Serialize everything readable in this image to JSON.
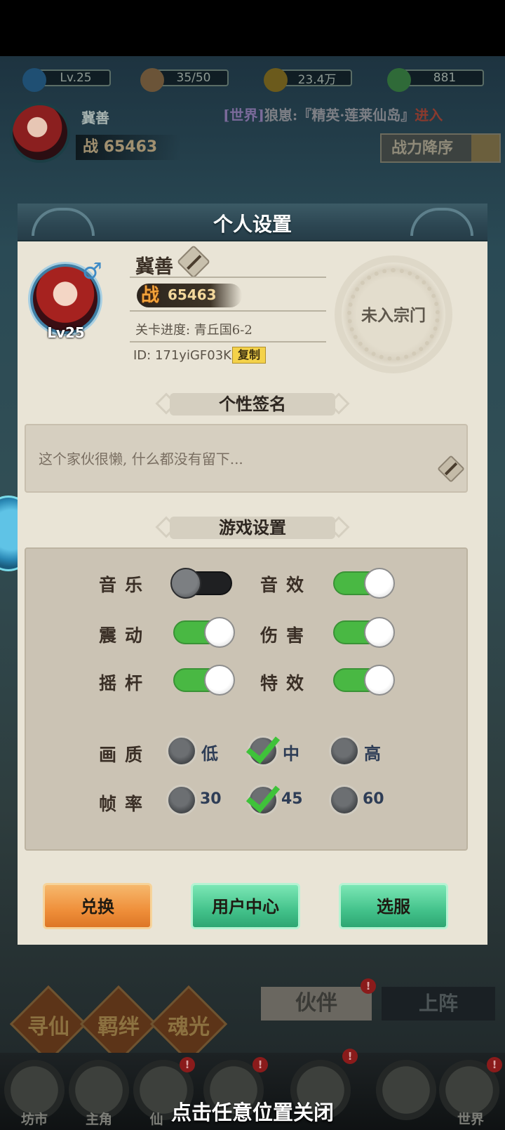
{
  "top_bar": {
    "level": "Lv.25",
    "stamina": "35/50",
    "coins": "23.4万",
    "gems": "881"
  },
  "player_bar": {
    "name": "冀善",
    "power_label": "战",
    "power_value": "65463"
  },
  "world_chat": {
    "tag": "[世界]",
    "message": "狼崽:『精英·莲莱仙岛』",
    "link": "进入"
  },
  "sort": {
    "label": "战力降序"
  },
  "modal": {
    "title": "个人设置",
    "name": "冀善",
    "level": "Lv25",
    "power_label": "战",
    "power_value": "65463",
    "stage_progress": "关卡进度: 青丘国6-2",
    "id_text": "ID: 171yiGF03K",
    "copy_label": "复制",
    "sect_status": "未入宗门",
    "signature_title": "个性签名",
    "signature_text": "这个家伙很懒, 什么都没有留下...",
    "settings_title": "游戏设置",
    "settings": {
      "music": {
        "label": "音乐",
        "on": false
      },
      "sfx": {
        "label": "音效",
        "on": true
      },
      "vibration": {
        "label": "震动",
        "on": true
      },
      "damage": {
        "label": "伤害",
        "on": true
      },
      "joystick": {
        "label": "摇杆",
        "on": true
      },
      "effects": {
        "label": "特效",
        "on": true
      }
    },
    "quality": {
      "label": "画质",
      "options": [
        "低",
        "中",
        "高"
      ],
      "selected": "中"
    },
    "framerate": {
      "label": "帧率",
      "options": [
        "30",
        "45",
        "60"
      ],
      "selected": "45"
    },
    "buttons": {
      "redeem": "兑换",
      "user_center": "用户中心",
      "server": "选服"
    }
  },
  "lower_bg": {
    "partner_tab": "伙伴",
    "deploy_tab": "上阵",
    "feature_buttons": [
      "寻仙",
      "羁绊",
      "魂光"
    ],
    "nav": [
      "坊市",
      "主角",
      "仙",
      "世界"
    ]
  },
  "close_hint": "点击任意位置关闭",
  "colors": {
    "toggle_on": "#49b843",
    "accent_orange": "#ef8f3a",
    "accent_green": "#43c28b"
  }
}
